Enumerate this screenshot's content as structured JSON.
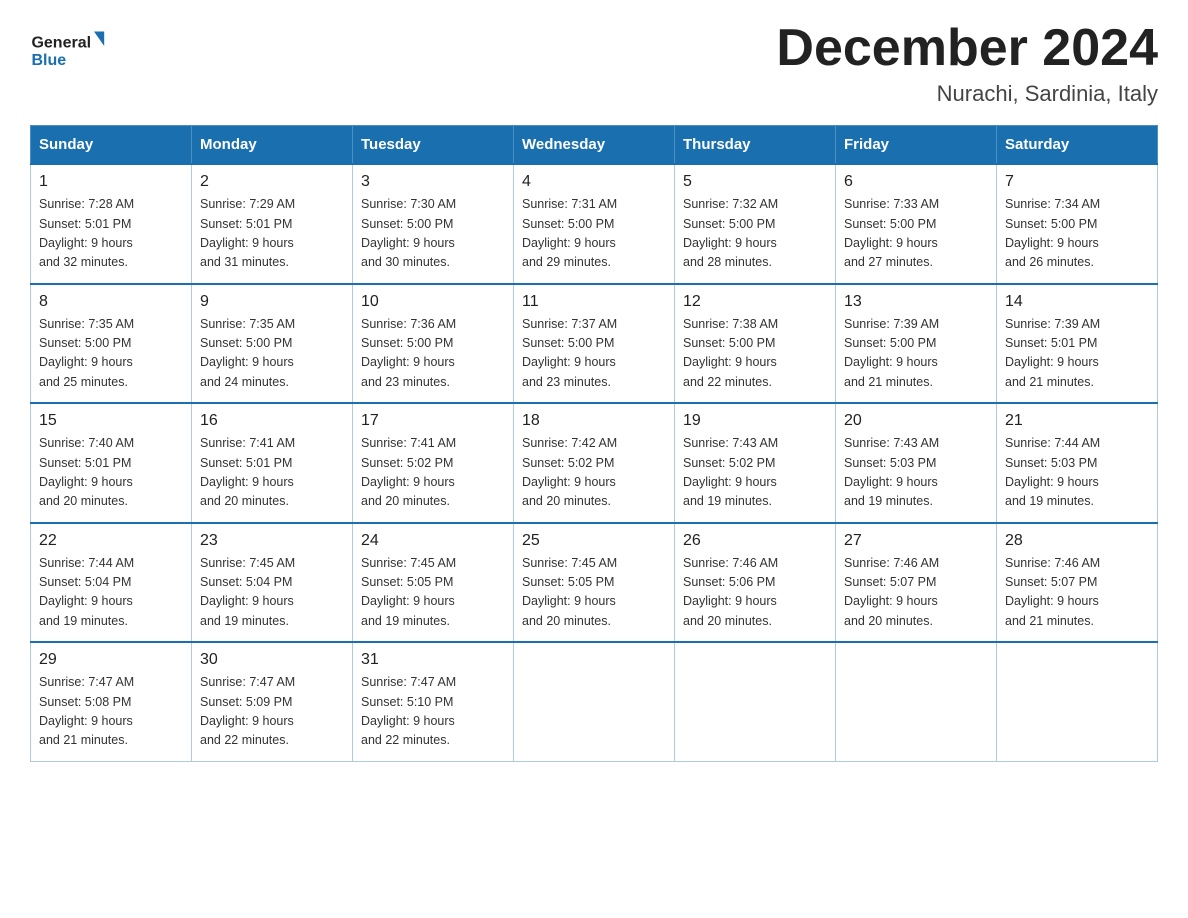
{
  "header": {
    "logo_general": "General",
    "logo_blue": "Blue",
    "month_title": "December 2024",
    "location": "Nurachi, Sardinia, Italy"
  },
  "weekdays": [
    "Sunday",
    "Monday",
    "Tuesday",
    "Wednesday",
    "Thursday",
    "Friday",
    "Saturday"
  ],
  "weeks": [
    [
      {
        "day": "1",
        "sunrise": "7:28 AM",
        "sunset": "5:01 PM",
        "daylight": "9 hours and 32 minutes."
      },
      {
        "day": "2",
        "sunrise": "7:29 AM",
        "sunset": "5:01 PM",
        "daylight": "9 hours and 31 minutes."
      },
      {
        "day": "3",
        "sunrise": "7:30 AM",
        "sunset": "5:00 PM",
        "daylight": "9 hours and 30 minutes."
      },
      {
        "day": "4",
        "sunrise": "7:31 AM",
        "sunset": "5:00 PM",
        "daylight": "9 hours and 29 minutes."
      },
      {
        "day": "5",
        "sunrise": "7:32 AM",
        "sunset": "5:00 PM",
        "daylight": "9 hours and 28 minutes."
      },
      {
        "day": "6",
        "sunrise": "7:33 AM",
        "sunset": "5:00 PM",
        "daylight": "9 hours and 27 minutes."
      },
      {
        "day": "7",
        "sunrise": "7:34 AM",
        "sunset": "5:00 PM",
        "daylight": "9 hours and 26 minutes."
      }
    ],
    [
      {
        "day": "8",
        "sunrise": "7:35 AM",
        "sunset": "5:00 PM",
        "daylight": "9 hours and 25 minutes."
      },
      {
        "day": "9",
        "sunrise": "7:35 AM",
        "sunset": "5:00 PM",
        "daylight": "9 hours and 24 minutes."
      },
      {
        "day": "10",
        "sunrise": "7:36 AM",
        "sunset": "5:00 PM",
        "daylight": "9 hours and 23 minutes."
      },
      {
        "day": "11",
        "sunrise": "7:37 AM",
        "sunset": "5:00 PM",
        "daylight": "9 hours and 23 minutes."
      },
      {
        "day": "12",
        "sunrise": "7:38 AM",
        "sunset": "5:00 PM",
        "daylight": "9 hours and 22 minutes."
      },
      {
        "day": "13",
        "sunrise": "7:39 AM",
        "sunset": "5:00 PM",
        "daylight": "9 hours and 21 minutes."
      },
      {
        "day": "14",
        "sunrise": "7:39 AM",
        "sunset": "5:01 PM",
        "daylight": "9 hours and 21 minutes."
      }
    ],
    [
      {
        "day": "15",
        "sunrise": "7:40 AM",
        "sunset": "5:01 PM",
        "daylight": "9 hours and 20 minutes."
      },
      {
        "day": "16",
        "sunrise": "7:41 AM",
        "sunset": "5:01 PM",
        "daylight": "9 hours and 20 minutes."
      },
      {
        "day": "17",
        "sunrise": "7:41 AM",
        "sunset": "5:02 PM",
        "daylight": "9 hours and 20 minutes."
      },
      {
        "day": "18",
        "sunrise": "7:42 AM",
        "sunset": "5:02 PM",
        "daylight": "9 hours and 20 minutes."
      },
      {
        "day": "19",
        "sunrise": "7:43 AM",
        "sunset": "5:02 PM",
        "daylight": "9 hours and 19 minutes."
      },
      {
        "day": "20",
        "sunrise": "7:43 AM",
        "sunset": "5:03 PM",
        "daylight": "9 hours and 19 minutes."
      },
      {
        "day": "21",
        "sunrise": "7:44 AM",
        "sunset": "5:03 PM",
        "daylight": "9 hours and 19 minutes."
      }
    ],
    [
      {
        "day": "22",
        "sunrise": "7:44 AM",
        "sunset": "5:04 PM",
        "daylight": "9 hours and 19 minutes."
      },
      {
        "day": "23",
        "sunrise": "7:45 AM",
        "sunset": "5:04 PM",
        "daylight": "9 hours and 19 minutes."
      },
      {
        "day": "24",
        "sunrise": "7:45 AM",
        "sunset": "5:05 PM",
        "daylight": "9 hours and 19 minutes."
      },
      {
        "day": "25",
        "sunrise": "7:45 AM",
        "sunset": "5:05 PM",
        "daylight": "9 hours and 20 minutes."
      },
      {
        "day": "26",
        "sunrise": "7:46 AM",
        "sunset": "5:06 PM",
        "daylight": "9 hours and 20 minutes."
      },
      {
        "day": "27",
        "sunrise": "7:46 AM",
        "sunset": "5:07 PM",
        "daylight": "9 hours and 20 minutes."
      },
      {
        "day": "28",
        "sunrise": "7:46 AM",
        "sunset": "5:07 PM",
        "daylight": "9 hours and 21 minutes."
      }
    ],
    [
      {
        "day": "29",
        "sunrise": "7:47 AM",
        "sunset": "5:08 PM",
        "daylight": "9 hours and 21 minutes."
      },
      {
        "day": "30",
        "sunrise": "7:47 AM",
        "sunset": "5:09 PM",
        "daylight": "9 hours and 22 minutes."
      },
      {
        "day": "31",
        "sunrise": "7:47 AM",
        "sunset": "5:10 PM",
        "daylight": "9 hours and 22 minutes."
      },
      null,
      null,
      null,
      null
    ]
  ],
  "labels": {
    "sunrise": "Sunrise:",
    "sunset": "Sunset:",
    "daylight": "Daylight:"
  }
}
